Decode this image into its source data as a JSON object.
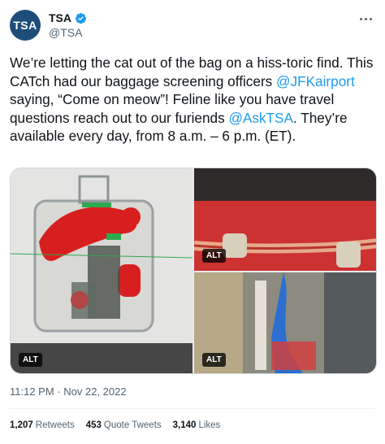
{
  "author": {
    "avatar_text": "TSA",
    "display_name": "TSA",
    "handle": "@TSA",
    "verified_icon": "verified-badge-icon",
    "brand_color": "#1d4e7a"
  },
  "tweet": {
    "text_1": "We’re letting the cat out of the bag on a hiss-toric find. This CATch had our baggage screening officers ",
    "mention_1": "@JFKairport",
    "text_2": " saying, “Come on meow”! Feline like you have travel questions reach out to our furiends ",
    "mention_2": "@AskTSA",
    "text_3": ". They’re available every day, from 8 a.m. – 6 p.m. (ET)."
  },
  "media": {
    "alt_label_1": "ALT",
    "alt_label_2": "ALT",
    "alt_label_3": "ALT"
  },
  "timestamp": "11:12 PM · Nov 22, 2022",
  "stats": {
    "retweets_count": "1,207",
    "retweets_label": "Retweets",
    "quotes_count": "453",
    "quotes_label": "Quote Tweets",
    "likes_count": "3,140",
    "likes_label": "Likes"
  },
  "colors": {
    "link": "#1d9bf0",
    "muted": "#536471",
    "text": "#0f1419"
  }
}
